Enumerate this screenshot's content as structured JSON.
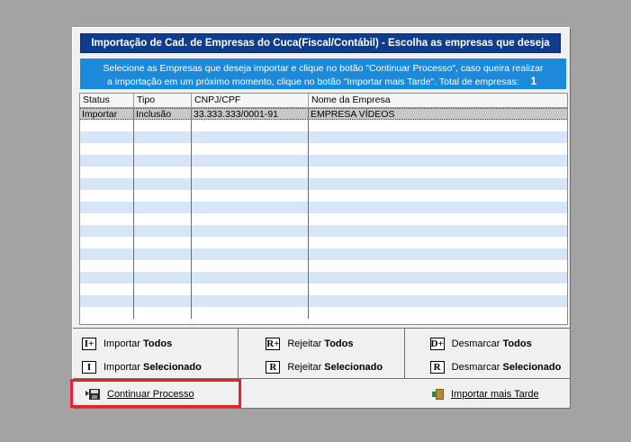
{
  "dialog": {
    "title": "Importação de Cad. de Empresas do Cuca(Fiscal/Contábil) - Escolha as empresas que deseja",
    "info_line1": "Selecione as Empresas que deseja importar e clique no botão \"Continuar Processo\", caso queira realizar",
    "info_line2": "a importação em um próximo momento, clique no botão \"Importar mais Tarde\". Total de empresas:",
    "total_count": "1"
  },
  "grid": {
    "columns": [
      "Status",
      "Tipo",
      "CNPJ/CPF",
      "Nome da Empresa"
    ],
    "rows": [
      {
        "status": "Importar",
        "tipo": "Inclusão",
        "cnpj": "33.333.333/0001-91",
        "nome": "EMPRESA VÍDEOS"
      }
    ]
  },
  "actions": {
    "import_all": {
      "prefix": "Importar",
      "suffix": "Todos",
      "icon": "I+"
    },
    "import_selected": {
      "prefix": "Importar",
      "suffix": "Selecionado",
      "icon": "I"
    },
    "reject_all": {
      "prefix": "Rejeitar",
      "suffix": "Todos",
      "icon": "R+"
    },
    "reject_selected": {
      "prefix": "Rejeitar",
      "suffix": "Selecionado",
      "icon": "R"
    },
    "unmark_all": {
      "prefix": "Desmarcar",
      "suffix": "Todos",
      "icon": "D+"
    },
    "unmark_selected": {
      "prefix": "Desmarcar",
      "suffix": "Selecionado",
      "icon": "R"
    }
  },
  "buttons": {
    "continue": "Continuar Processo",
    "import_later": "Importar mais Tarde"
  },
  "colors": {
    "title_bg": "#0f3c8c",
    "info_bg": "#1c8ad8",
    "row_alt": "#d6e6f6",
    "highlight": "#e8222a"
  }
}
